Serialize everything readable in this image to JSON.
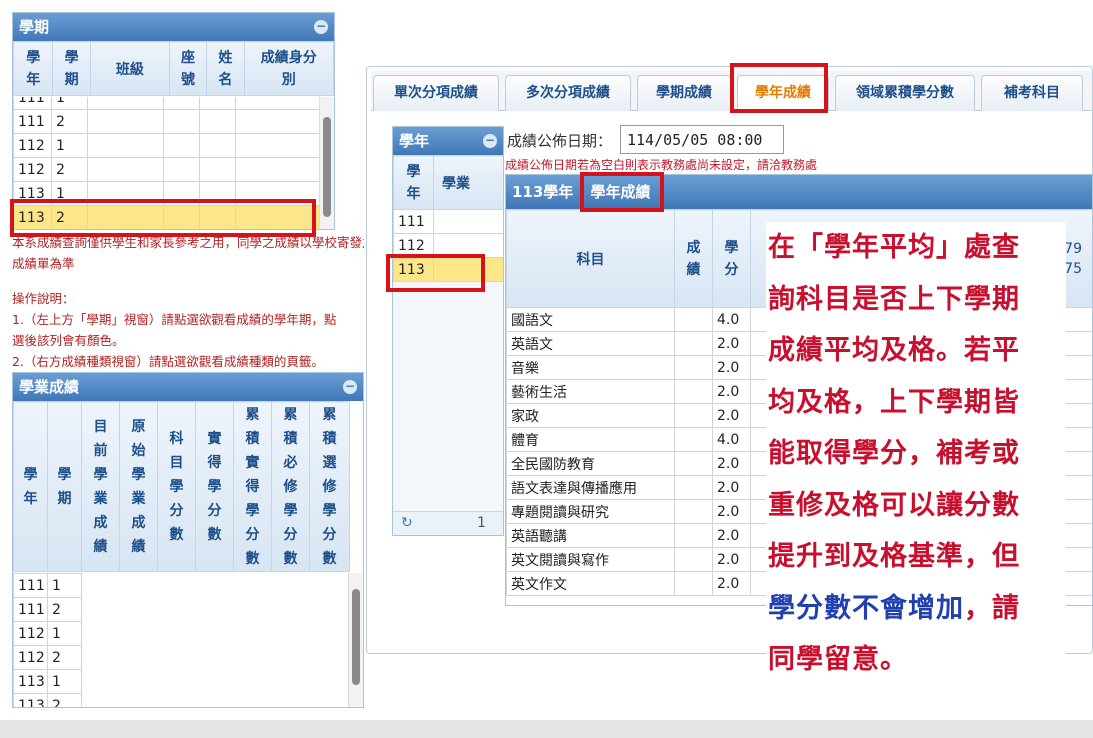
{
  "semester_panel": {
    "title": "學期",
    "headers": [
      "學年",
      "學期",
      "班級",
      "座號",
      "姓名",
      "成績身分別"
    ],
    "rows": [
      {
        "year": "111",
        "term": "1"
      },
      {
        "year": "111",
        "term": "2"
      },
      {
        "year": "112",
        "term": "1"
      },
      {
        "year": "112",
        "term": "2"
      },
      {
        "year": "113",
        "term": "1"
      },
      {
        "year": "113",
        "term": "2"
      }
    ]
  },
  "notes": {
    "line1": "本系成績查詢僅供學生和家長參考之用，同學之成績以學校寄發之",
    "line2": "成績單為準",
    "line3": "操作說明：",
    "line4": "1.（左上方「學期」視窗）請點選欲觀看成績的學年期，點",
    "line5": "選後該列會有顏色。",
    "line6": "2.（右方成績種類視窗）請點選欲觀看成績種類的頁籤。"
  },
  "academic_panel": {
    "title": "學業成績",
    "headers": [
      "學年",
      "學期",
      "目前學業成績",
      "原始學業成績",
      "科目學分數",
      "實得學分數",
      "累積實得學分數",
      "累積必修學分數",
      "累積選修學分數"
    ],
    "rows": [
      {
        "year": "111",
        "term": "1"
      },
      {
        "year": "111",
        "term": "2"
      },
      {
        "year": "112",
        "term": "1"
      },
      {
        "year": "112",
        "term": "2"
      },
      {
        "year": "113",
        "term": "1"
      },
      {
        "year": "113",
        "term": "2"
      }
    ]
  },
  "tabs": [
    "單次分項成績",
    "多次分項成績",
    "學期成績",
    "學年成績",
    "領域累積學分數",
    "補考科目"
  ],
  "year_panel": {
    "title": "學年",
    "headers": [
      "學年",
      "學業"
    ],
    "rows": [
      "111",
      "112",
      "113"
    ],
    "pager": "1"
  },
  "date": {
    "label": "成績公佈日期：",
    "value": "114/05/05 08:00",
    "note": "成績公佈日期若為空白則表示教務處尚未設定，請洽教務處"
  },
  "year_grade_panel": {
    "title_year": "113學年",
    "title_label": "學年成績",
    "headers": [
      "科目",
      "成績",
      "學分"
    ],
    "partial_header_right": "79",
    "partial_header_right2": "~75",
    "subjects": [
      {
        "name": "國語文",
        "credit": "4.0"
      },
      {
        "name": "英語文",
        "credit": "2.0"
      },
      {
        "name": "音樂",
        "credit": "2.0"
      },
      {
        "name": "藝術生活",
        "credit": "2.0"
      },
      {
        "name": "家政",
        "credit": "2.0"
      },
      {
        "name": "體育",
        "credit": "4.0"
      },
      {
        "name": "全民國防教育",
        "credit": "2.0"
      },
      {
        "name": "語文表達與傳播應用",
        "credit": "2.0"
      },
      {
        "name": "專題閱讀與研究",
        "credit": "2.0"
      },
      {
        "name": "英語聽講",
        "credit": "2.0"
      },
      {
        "name": "英文閱讀與寫作",
        "credit": "2.0"
      },
      {
        "name": "英文作文",
        "credit": "2.0"
      }
    ]
  },
  "callout": {
    "line1": "在「學年平均」處查",
    "line2": "詢科目是否上下學期",
    "line3": "成績平均及格。若平",
    "line4": "均及格，上下學期皆",
    "line5": "能取得學分，補考或",
    "line6": "重修及格可以讓分數",
    "line7": "提升到及格基準，但",
    "line8a": "學分數不會增加",
    "line8b": "，請",
    "line9": "同學留意。"
  },
  "colors": {
    "header_blue": "#3f78b8",
    "highlight": "#fbe68a",
    "red_box": "#d6131b",
    "active_tab": "#e07b00",
    "callout_red": "#c8102e",
    "callout_blue": "#2140b0"
  }
}
